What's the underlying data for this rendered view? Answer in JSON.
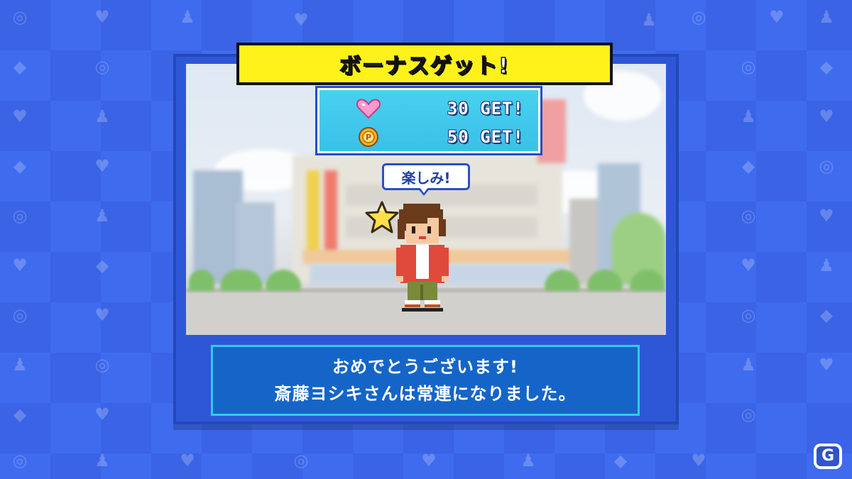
{
  "title_banner": {
    "text": "ボーナスゲット!"
  },
  "rewards": [
    {
      "icon": "heart-icon",
      "text": "30 GET!"
    },
    {
      "icon": "p-coin-icon",
      "text": "50 GET!"
    }
  ],
  "speech_bubble": {
    "text": "楽しみ!"
  },
  "message": {
    "line1": "おめでとうございます!",
    "line2": "斎藤ヨシキさんは常連になりました。"
  },
  "watermark": {
    "letter": "G"
  },
  "colors": {
    "background": "#3a63e6",
    "banner": "#fff21a",
    "rewards_box": "#48d0f0",
    "message_box": "#1565c8",
    "message_border": "#35c8f0"
  }
}
